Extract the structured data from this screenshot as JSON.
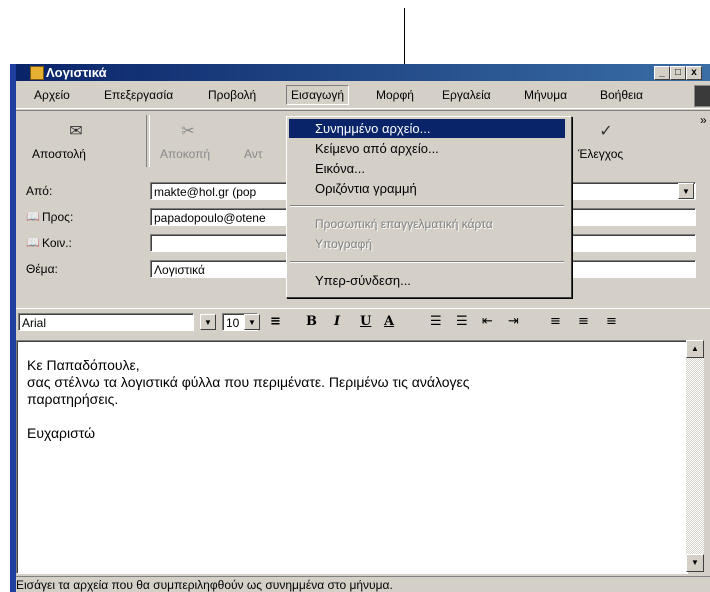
{
  "window": {
    "title": "Λογιστικά",
    "controls": [
      "_",
      "□",
      "x"
    ]
  },
  "menubar": [
    {
      "label": "Αρχείο"
    },
    {
      "label": "Επεξεργασία"
    },
    {
      "label": "Προβολή"
    },
    {
      "label": "Εισαγωγή",
      "active": true
    },
    {
      "label": "Μορφή"
    },
    {
      "label": "Εργαλεία"
    },
    {
      "label": "Μήνυμα"
    },
    {
      "label": "Βοήθεια"
    }
  ],
  "toolbar": {
    "send_label": "Αποστολή",
    "cut_label": "Αποκοπή",
    "copy_label": "Αντ",
    "check_label": "Έλεγχος",
    "overflow": "»"
  },
  "header": {
    "from_label": "Από:",
    "from_value": "makte@hol.gr   (pop",
    "to_label": "Προς:",
    "to_value": "papadopoulo@otene",
    "cc_label": "Κοιν.:",
    "cc_value": "",
    "subject_label": "Θέμα:",
    "subject_value": "Λογιστικά"
  },
  "format": {
    "font": "Arial",
    "size": "10",
    "bold": "B",
    "italic": "I",
    "underline": "U",
    "color": "A"
  },
  "insert_menu": [
    {
      "label": "Συνημμένο αρχείο...",
      "state": "selected"
    },
    {
      "label": "Κείμενο από αρχείο...",
      "state": "normal"
    },
    {
      "label": "Εικόνα...",
      "state": "normal"
    },
    {
      "label": "Οριζόντια γραμμή",
      "state": "normal"
    },
    {
      "label": "Προσωπική επαγγελματική κάρτα",
      "state": "disabled"
    },
    {
      "label": "Υπογραφή",
      "state": "disabled"
    },
    {
      "label": "Υπερ-σύνδεση...",
      "state": "normal"
    }
  ],
  "message": {
    "line1": "Κε Παπαδόπουλε,",
    "line2": "σας στέλνω τα λογιστικά φύλλα που περιμένατε. Περιμένω τις ανάλογες",
    "line3": "παρατηρήσεις.",
    "line4": "Ευχαριστώ"
  },
  "status": "Εισάγει τα αρχεία που θα συμπεριληφθούν ως συνημμένα στο μήνυμα."
}
